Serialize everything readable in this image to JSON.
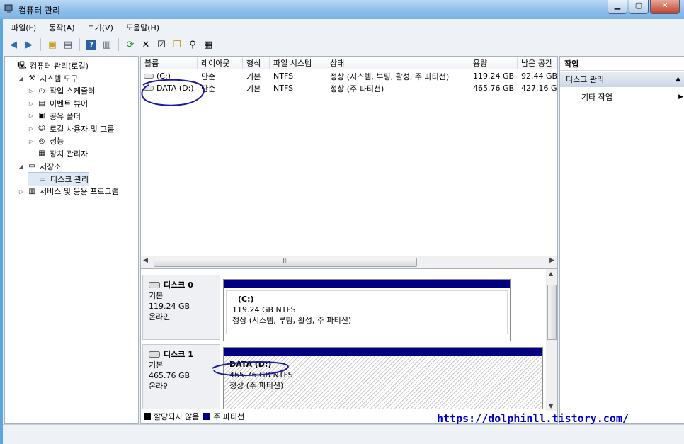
{
  "window": {
    "title": "컴퓨터 관리"
  },
  "menu": [
    "파일(F)",
    "동작(A)",
    "보기(V)",
    "도움말(H)"
  ],
  "tree": [
    {
      "label": "컴퓨터 관리(로컬)",
      "indent": 0,
      "exp": "",
      "icon": "computer-icon"
    },
    {
      "label": "시스템 도구",
      "indent": 1,
      "exp": "◢",
      "icon": "tools-icon"
    },
    {
      "label": "작업 스케줄러",
      "indent": 2,
      "exp": "▷",
      "icon": "clock-icon"
    },
    {
      "label": "이벤트 뷰어",
      "indent": 2,
      "exp": "▷",
      "icon": "event-viewer-icon"
    },
    {
      "label": "공유 폴더",
      "indent": 2,
      "exp": "▷",
      "icon": "shared-folder-icon"
    },
    {
      "label": "로컬 사용자 및 그룹",
      "indent": 2,
      "exp": "▷",
      "icon": "users-icon"
    },
    {
      "label": "성능",
      "indent": 2,
      "exp": "▷",
      "icon": "performance-icon"
    },
    {
      "label": "장치 관리자",
      "indent": 2,
      "exp": "",
      "icon": "device-manager-icon"
    },
    {
      "label": "저장소",
      "indent": 1,
      "exp": "◢",
      "icon": "storage-icon"
    },
    {
      "label": "디스크 관리",
      "indent": 2,
      "exp": "",
      "icon": "disk-management-icon",
      "selected": true
    },
    {
      "label": "서비스 및 응용 프로그램",
      "indent": 1,
      "exp": "▷",
      "icon": "services-icon"
    }
  ],
  "volume_table": {
    "columns": [
      "볼륨",
      "레이아웃",
      "형식",
      "파일 시스템",
      "상태",
      "용량",
      "남은 공간"
    ],
    "rows": [
      [
        "(C:)",
        "단순",
        "기본",
        "NTFS",
        "정상 (시스템, 부팅, 활성, 주 파티션)",
        "119.24 GB",
        "92.44 GB"
      ],
      [
        "DATA (D:)",
        "단순",
        "기본",
        "NTFS",
        "정상 (주 파티션)",
        "465.76 GB",
        "427.16 GB"
      ]
    ],
    "scroll_label": "III"
  },
  "disks": [
    {
      "name": "디스크 0",
      "type": "기본",
      "size": "119.24 GB",
      "status": "온라인",
      "partition": {
        "label": "(C:)",
        "fs": "119.24 GB NTFS",
        "state": "정상 (시스템, 부팅, 활성, 주 파티션)"
      }
    },
    {
      "name": "디스크 1",
      "type": "기본",
      "size": "465.76 GB",
      "status": "온라인",
      "partition": {
        "label": "DATA  (D:)",
        "fs": "465.76 GB NTFS",
        "state": "정상 (주 파티션)"
      }
    }
  ],
  "legend": [
    {
      "label": "할당되지 않음",
      "color": "#000000"
    },
    {
      "label": "주 파티션",
      "color": "#000080"
    }
  ],
  "actions": {
    "header": "작업",
    "section": "디스크 관리",
    "item": "기타 작업"
  },
  "watermark": "https://dolphinll.tistory.com/",
  "colors": {
    "primary_partition": "#000080",
    "selection": "#dfe9f6",
    "annotation": "#1a1aa6"
  }
}
